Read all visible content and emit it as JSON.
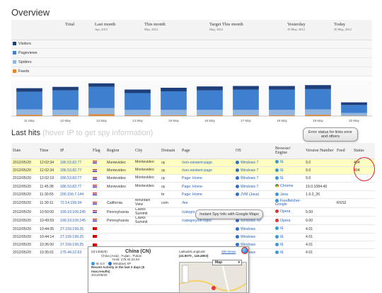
{
  "overview": {
    "title": "Overview",
    "columns": [
      {
        "label": "Total",
        "sub": ""
      },
      {
        "label": "Last month",
        "sub": "Apr, 2012"
      },
      {
        "label": "This month",
        "sub": "May, 2012"
      },
      {
        "label": "Target This month",
        "sub": "May, 2012"
      },
      {
        "label": "Yesterday",
        "sub": "19 May, 2012"
      },
      {
        "label": "Today",
        "sub": "20 May, 2012"
      }
    ],
    "rows": [
      {
        "label": "Visitors",
        "color": "#1f3f7a"
      },
      {
        "label": "Pageviews",
        "color": "#3f7fd0"
      },
      {
        "label": "Spiders",
        "color": "#8fb5e0"
      },
      {
        "label": "Feeds",
        "color": "#e8872b"
      }
    ]
  },
  "chart_data": {
    "type": "bar",
    "categories": [
      "11 May",
      "12 May",
      "13 May",
      "14 May",
      "15 May",
      "16 May",
      "17 May",
      "18 May",
      "19 May",
      "20 May"
    ],
    "series": [
      {
        "name": "Visitors",
        "values": [
          8,
          8,
          8,
          8,
          8,
          9,
          8,
          8,
          9,
          6
        ]
      },
      {
        "name": "Pageviews",
        "values": [
          40,
          44,
          48,
          38,
          42,
          44,
          46,
          46,
          46,
          18
        ]
      },
      {
        "name": "Spiders",
        "values": [
          12,
          12,
          14,
          12,
          12,
          12,
          12,
          12,
          12,
          6
        ]
      },
      {
        "name": "Feeds",
        "values": [
          3,
          2,
          4,
          2,
          2,
          2,
          2,
          2,
          3,
          1
        ]
      }
    ],
    "ylim": [
      0,
      80
    ],
    "colors": [
      "#1f3f7a",
      "#3f7fd0",
      "#8fb5e0",
      "#e8872b"
    ]
  },
  "hits": {
    "title": "Last hits",
    "hint": "(hover IP to get spy information)",
    "headers": [
      "Date",
      "Time",
      "IP",
      "Flag",
      "Region",
      "City",
      "Domain",
      "Page",
      "OS",
      "Browser/ Engine",
      "Version Number",
      "Feed",
      "Status"
    ],
    "rows": [
      {
        "date": "2012/05/20",
        "time": "12:02:34",
        "ip": "186.53.82.77",
        "region": "Montevideo",
        "city": "Montevideo",
        "domain": "uy",
        "page": "/non-existent-page",
        "os": "Windows 7",
        "browser": "IE",
        "version": "9.0",
        "feed": "",
        "status": "404",
        "err": true
      },
      {
        "date": "2012/05/20",
        "time": "12:02:34",
        "ip": "186.53.82.77",
        "region": "Montevideo",
        "city": "Montevideo",
        "domain": "uy",
        "page": "/non-existent-page",
        "os": "Windows 7",
        "browser": "IE",
        "version": "9.0",
        "feed": "",
        "status": "404",
        "err": true
      },
      {
        "date": "2012/05/20",
        "time": "12:02:19",
        "ip": "186.53.82.77",
        "region": "Montevideo",
        "city": "Montevideo",
        "domain": "uy",
        "page": "Page: Home",
        "os": "Windows 7",
        "browser": "IE",
        "version": "9.0",
        "feed": "",
        "status": ""
      },
      {
        "date": "2012/05/20",
        "time": "11:45:38",
        "ip": "186.53.82.77",
        "region": "Montevideo",
        "city": "Montevideo",
        "domain": "uy",
        "page": "Page: Home",
        "os": "Windows 7",
        "browser": "Chrome",
        "version": "19.0.1084.46",
        "feed": "",
        "status": ""
      },
      {
        "date": "2012/05/20",
        "time": "11:30:55",
        "ip": "200.150.7.144",
        "region": "",
        "city": "",
        "domain": "br",
        "page": "Page: Home",
        "os": "JVM (Java)",
        "browser": "Java",
        "version": "1.6.0_26",
        "feed": "",
        "status": ""
      },
      {
        "date": "2012/05/20",
        "time": "11:30:11",
        "ip": "72.14.199.34",
        "region": "California",
        "city": "Mountain View",
        "domain": "com",
        "page": "/fee",
        "os": "",
        "browser": "Feedfetcher-Google",
        "version": "",
        "feed": "RSS2",
        "status": ""
      },
      {
        "date": "2012/05/20",
        "time": "10:50:00",
        "ip": "199.19.109.245",
        "region": "Pennsylvania",
        "city": "Clarks Summit",
        "domain": "",
        "page": "/categor",
        "os": "",
        "browser": "Opera",
        "version": "9.00",
        "feed": "",
        "status": ""
      },
      {
        "date": "2012/05/20",
        "time": "10:49:59",
        "ip": "199.19.109.245",
        "region": "Pennsylvania",
        "city": "Clarks Summit",
        "domain": "",
        "page": "/category/off-topic/",
        "os": "Windows XP",
        "browser": "Opera",
        "version": "9.00",
        "feed": "",
        "status": ""
      },
      {
        "date": "2012/05/20",
        "time": "10:44:35",
        "ip": "27.159.199.25",
        "region": "",
        "city": "",
        "domain": "",
        "page": "",
        "os": "Windows",
        "browser": "IE",
        "version": "4.01",
        "feed": "",
        "status": ""
      },
      {
        "date": "2012/05/20",
        "time": "10:44:14",
        "ip": "27.159.199.25",
        "region": "",
        "city": "",
        "domain": "",
        "page": "",
        "os": "Windows",
        "browser": "IE",
        "version": "4.01",
        "feed": "",
        "status": ""
      },
      {
        "date": "2012/05/20",
        "time": "10:36:00",
        "ip": "27.159.199.25",
        "region": "",
        "city": "",
        "domain": "",
        "page": "",
        "os": "Windows",
        "browser": "IE",
        "version": "4.01",
        "feed": "",
        "status": ""
      },
      {
        "date": "2012/05/20",
        "time": "10:35:01",
        "ip": "175.44.22.63",
        "region": "",
        "city": "",
        "domain": "",
        "page": "",
        "os": "Windows",
        "browser": "IE",
        "version": "4.01",
        "feed": "",
        "status": ""
      }
    ]
  },
  "callouts": {
    "error": "Error status for links error and others",
    "spy": "Instant Spy Info with Google Maps"
  },
  "popup": {
    "id": "(id:145625)",
    "country": "China (CN)",
    "region": "China (Asia) , Fujian , Putian",
    "host": "Host: 175.44.22.63",
    "browser": "IE 6.0",
    "os": "Windows XP",
    "activity": "Recent Activity in the last 2 days (5 max.results)",
    "activity_date": "2012/05/20",
    "latlong": "Latitude/Longitude",
    "coords": "(24.9070 , 118.4903)",
    "site_news": "Site News",
    "map_type": "Map"
  }
}
